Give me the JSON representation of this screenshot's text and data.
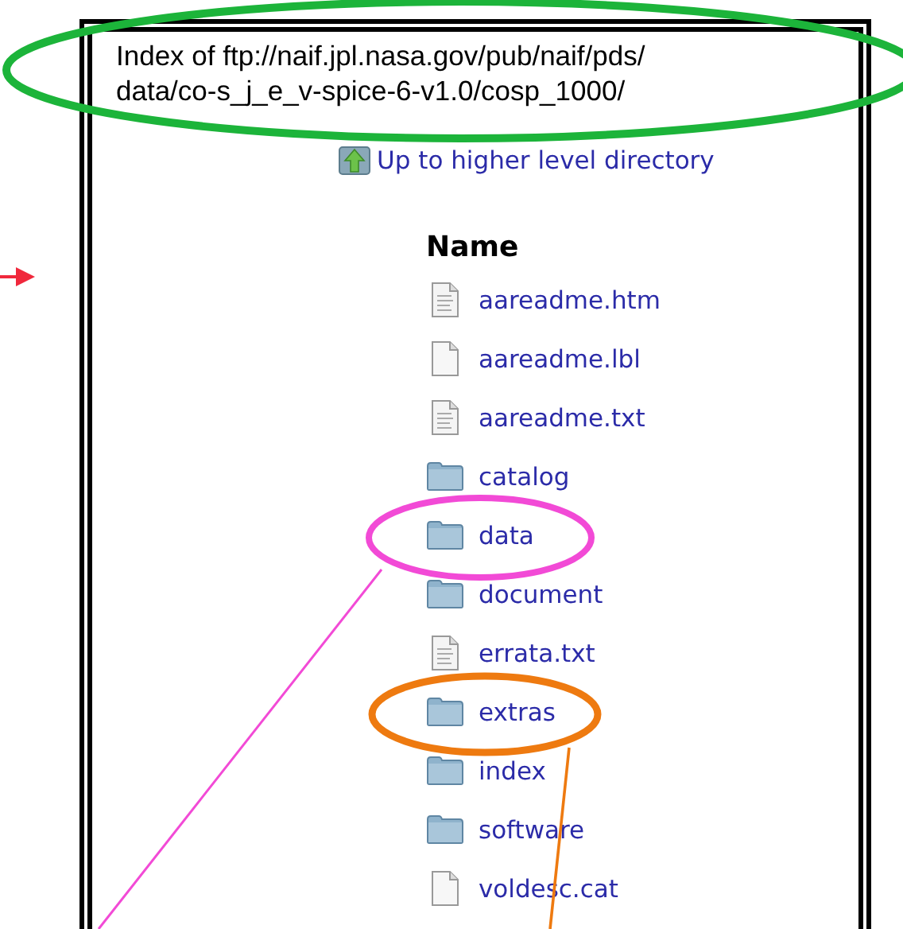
{
  "title_lines": [
    "Index of ftp://naif.jpl.nasa.gov/pub/naif/pds/",
    "data/co-s_j_e_v-spice-6-v1.0/cosp_1000/"
  ],
  "parent_link": "Up to higher level directory",
  "column_header": "Name",
  "entries": [
    {
      "name": "aareadme.htm",
      "kind": "text"
    },
    {
      "name": "aareadme.lbl",
      "kind": "file"
    },
    {
      "name": "aareadme.txt",
      "kind": "text"
    },
    {
      "name": "catalog",
      "kind": "folder"
    },
    {
      "name": "data",
      "kind": "folder"
    },
    {
      "name": "document",
      "kind": "folder"
    },
    {
      "name": "errata.txt",
      "kind": "text"
    },
    {
      "name": "extras",
      "kind": "folder"
    },
    {
      "name": "index",
      "kind": "folder"
    },
    {
      "name": "software",
      "kind": "folder"
    },
    {
      "name": "voldesc.cat",
      "kind": "file"
    }
  ]
}
